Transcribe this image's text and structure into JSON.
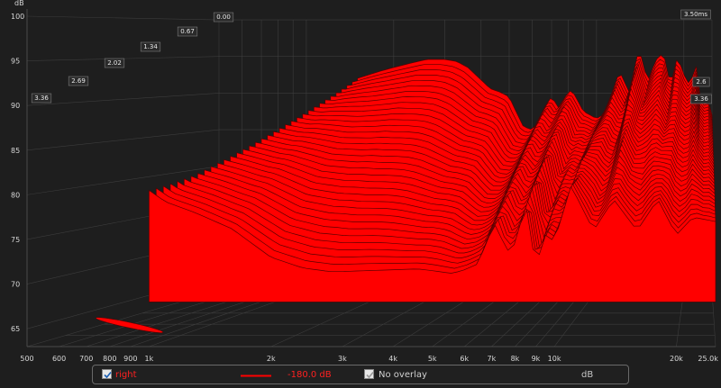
{
  "chart_data": {
    "type": "area",
    "subtype": "waterfall-3d",
    "y_unit": "dB",
    "y_ticks": [
      "100",
      "95",
      "90",
      "85",
      "80",
      "75",
      "70",
      "65"
    ],
    "x_ticks": [
      "500",
      "600",
      "700",
      "800",
      "900",
      "1k",
      "2k",
      "3k",
      "4k",
      "5k",
      "6k",
      "7k",
      "8k",
      "9k",
      "10k",
      "20k",
      "25.0k Hz"
    ],
    "x_range_hz": [
      500,
      25000
    ],
    "y_range_db": [
      63,
      100
    ],
    "depth_ticks_left": [
      "0.00",
      "0.67",
      "1.34",
      "2.02",
      "2.69",
      "3.36"
    ],
    "depth_ticks_right": [
      "3.50ms",
      "2.6",
      "3.36"
    ],
    "depth_unit": "ms",
    "depth_range_ms": [
      0,
      3.5
    ],
    "grid": true,
    "series": [
      {
        "name": "right",
        "color": "#ff0000",
        "front_curve": {
          "x_hz": [
            1000,
            1100,
            1300,
            1600,
            2000,
            2400,
            2800,
            3000,
            3400,
            4000,
            4600,
            5000,
            5600,
            6000,
            6500,
            6800,
            7200,
            7600,
            8000,
            8500,
            9000,
            9500,
            10000,
            11000,
            12500,
            14000,
            16000,
            18000,
            20000,
            22000,
            25000
          ],
          "db": [
            80.5,
            79.2,
            78.0,
            76.2,
            73.0,
            71.8,
            71.4,
            71.4,
            71.5,
            71.6,
            71.7,
            71.5,
            71.2,
            71.6,
            72.3,
            74.8,
            76.8,
            73.6,
            74.5,
            79.0,
            72.0,
            75.5,
            74.8,
            81.0,
            76.0,
            79.5,
            76.0,
            79.5,
            75.5,
            77.5,
            77.0
          ]
        },
        "back_curve": {
          "x_hz": [
            1500,
            1800,
            2000,
            2300,
            2600,
            3000,
            3300,
            3600,
            4000,
            4300,
            4600,
            5000,
            5200,
            5600,
            6000,
            6300,
            6600,
            7000,
            7400,
            7800,
            8200,
            8600,
            9000,
            9500,
            10000,
            10500,
            11000,
            12000,
            13000,
            14000,
            15000,
            16000,
            17000,
            18000,
            19000,
            20000,
            21000,
            22000,
            23000,
            24000,
            25000
          ],
          "db": [
            92.0,
            93.0,
            93.5,
            94.1,
            94.6,
            94.6,
            94.3,
            93.5,
            91.8,
            90.6,
            90.2,
            89.5,
            88.0,
            85.4,
            85.0,
            86.0,
            88.0,
            89.5,
            88.0,
            89.5,
            90.5,
            89.0,
            87.5,
            87.0,
            86.5,
            87.0,
            88.5,
            93.0,
            90.0,
            96.2,
            91.5,
            94.5,
            95.5,
            91.0,
            95.0,
            92.5,
            91.0,
            94.0,
            88.0,
            89.5,
            87.0
          ]
        }
      }
    ],
    "legend": {
      "series_name": "right",
      "series_checked": true,
      "offset_value": "-180.0 dB",
      "overlay_label": "No overlay",
      "overlay_checked": true,
      "unit": "dB"
    }
  }
}
